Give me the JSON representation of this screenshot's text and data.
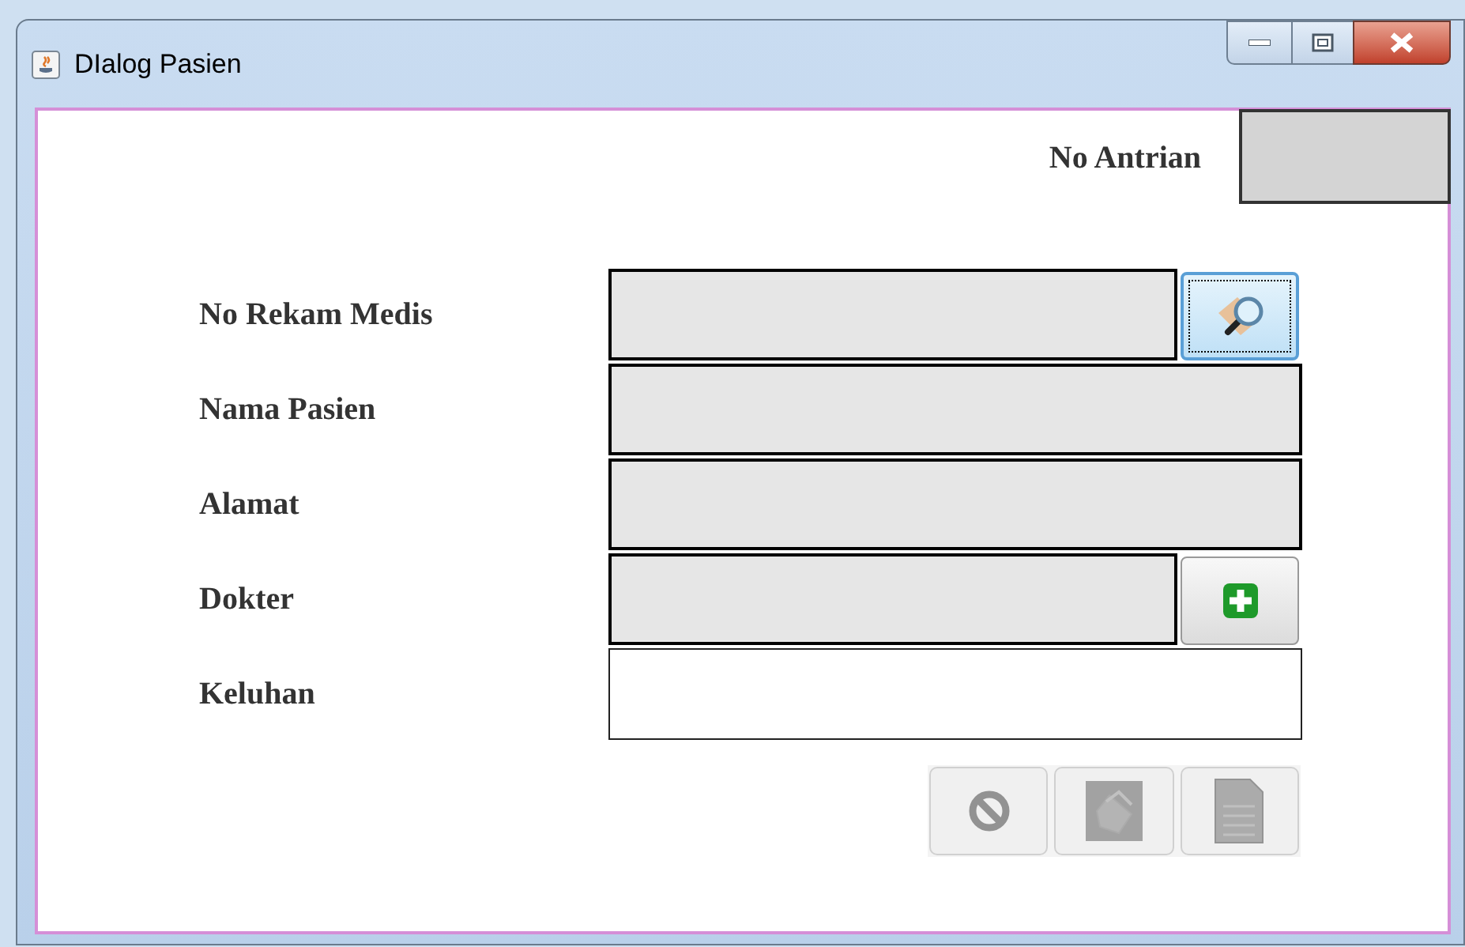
{
  "window": {
    "title": "DIalog Pasien"
  },
  "queue": {
    "label": "No Antrian"
  },
  "form": [
    {
      "label": "No Rekam Medis",
      "editable": false,
      "button": {
        "kind": "search",
        "focused": true
      }
    },
    {
      "label": "Nama Pasien",
      "editable": false
    },
    {
      "label": "Alamat",
      "editable": false
    },
    {
      "label": "Dokter",
      "editable": false,
      "button": {
        "kind": "add",
        "focused": false
      }
    },
    {
      "label": "Keluhan",
      "editable": true
    }
  ],
  "actions": [
    {
      "kind": "cancel",
      "disabled": true
    },
    {
      "kind": "print",
      "disabled": true
    },
    {
      "kind": "document",
      "disabled": true
    }
  ]
}
